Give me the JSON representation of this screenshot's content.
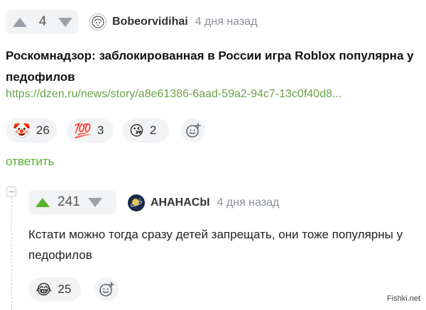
{
  "post": {
    "score": "4",
    "author": "Bobeorvidihai",
    "time": "4 дня назад",
    "title": "Роскомнадзор: заблокированная в России игра Roblox популярна у педофилов",
    "link": "https://dzen.ru/news/story/a8e61386-6aad-59a2-94c7-13c0f40d8...",
    "reactions": [
      {
        "emoji": "🤡",
        "count": "26"
      },
      {
        "emoji": "💯",
        "count": "3"
      },
      {
        "emoji": "😘",
        "count": "2"
      }
    ],
    "reply_label": "ответить"
  },
  "reply": {
    "score": "241",
    "author": "AHAHACbI",
    "time": "4 дня назад",
    "text": "Кстати можно тогда сразу детей запрещать, они тоже популярны у педофилов",
    "reactions": [
      {
        "emoji": "😂",
        "count": "25"
      }
    ]
  },
  "watermark": "Fishki.net",
  "colors": {
    "upvote_active": "#5ab031",
    "link": "#6ba04a",
    "pill_bg": "#f2f3f5"
  }
}
